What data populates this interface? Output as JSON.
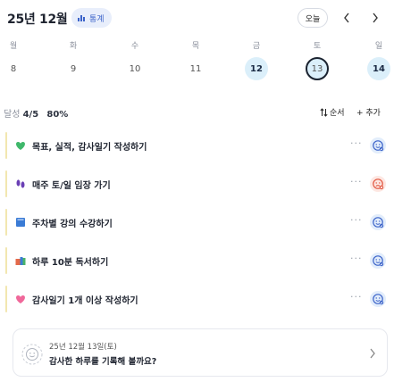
{
  "header": {
    "month": "25년 12월",
    "stats_label": "통계",
    "today_label": "오늘"
  },
  "weekdays": [
    "월",
    "화",
    "수",
    "목",
    "금",
    "토",
    "일"
  ],
  "days": [
    {
      "num": "8",
      "state": "none"
    },
    {
      "num": "9",
      "state": "none"
    },
    {
      "num": "10",
      "state": "none"
    },
    {
      "num": "11",
      "state": "none"
    },
    {
      "num": "12",
      "state": "done"
    },
    {
      "num": "13",
      "state": "selected"
    },
    {
      "num": "14",
      "state": "done"
    }
  ],
  "progress": {
    "label": "달성",
    "count": "4/5",
    "percent": "80%"
  },
  "toolbar": {
    "order_label": "순서",
    "add_label": "+ 추가"
  },
  "tasks": [
    {
      "label": "목표, 실적, 감사일기 작성하기",
      "emoji": "green-heart-icon",
      "bar_color": "#f2e7b0",
      "status": "done"
    },
    {
      "label": "매주 토/일 임장 가기",
      "emoji": "footprints-icon",
      "bar_color": "#f2e7b0",
      "status": "failed"
    },
    {
      "label": "주차별 강의 수강하기",
      "emoji": "book-icon",
      "bar_color": "#f2e7b0",
      "status": "done"
    },
    {
      "label": "하루 10분 독서하기",
      "emoji": "books-icon",
      "bar_color": "#f2e7b0",
      "status": "done"
    },
    {
      "label": "감사일기 1개 이상 작성하기",
      "emoji": "pink-heart-icon",
      "bar_color": "#f2e7b0",
      "status": "done"
    }
  ],
  "journal": {
    "date": "25년 12월 13일(토)",
    "prompt": "감사한 하루를 기록해 볼까요?"
  },
  "colors": {
    "accent": "#3b63c9",
    "done_bg": "#dbeffa",
    "fail": "#e2553f"
  }
}
